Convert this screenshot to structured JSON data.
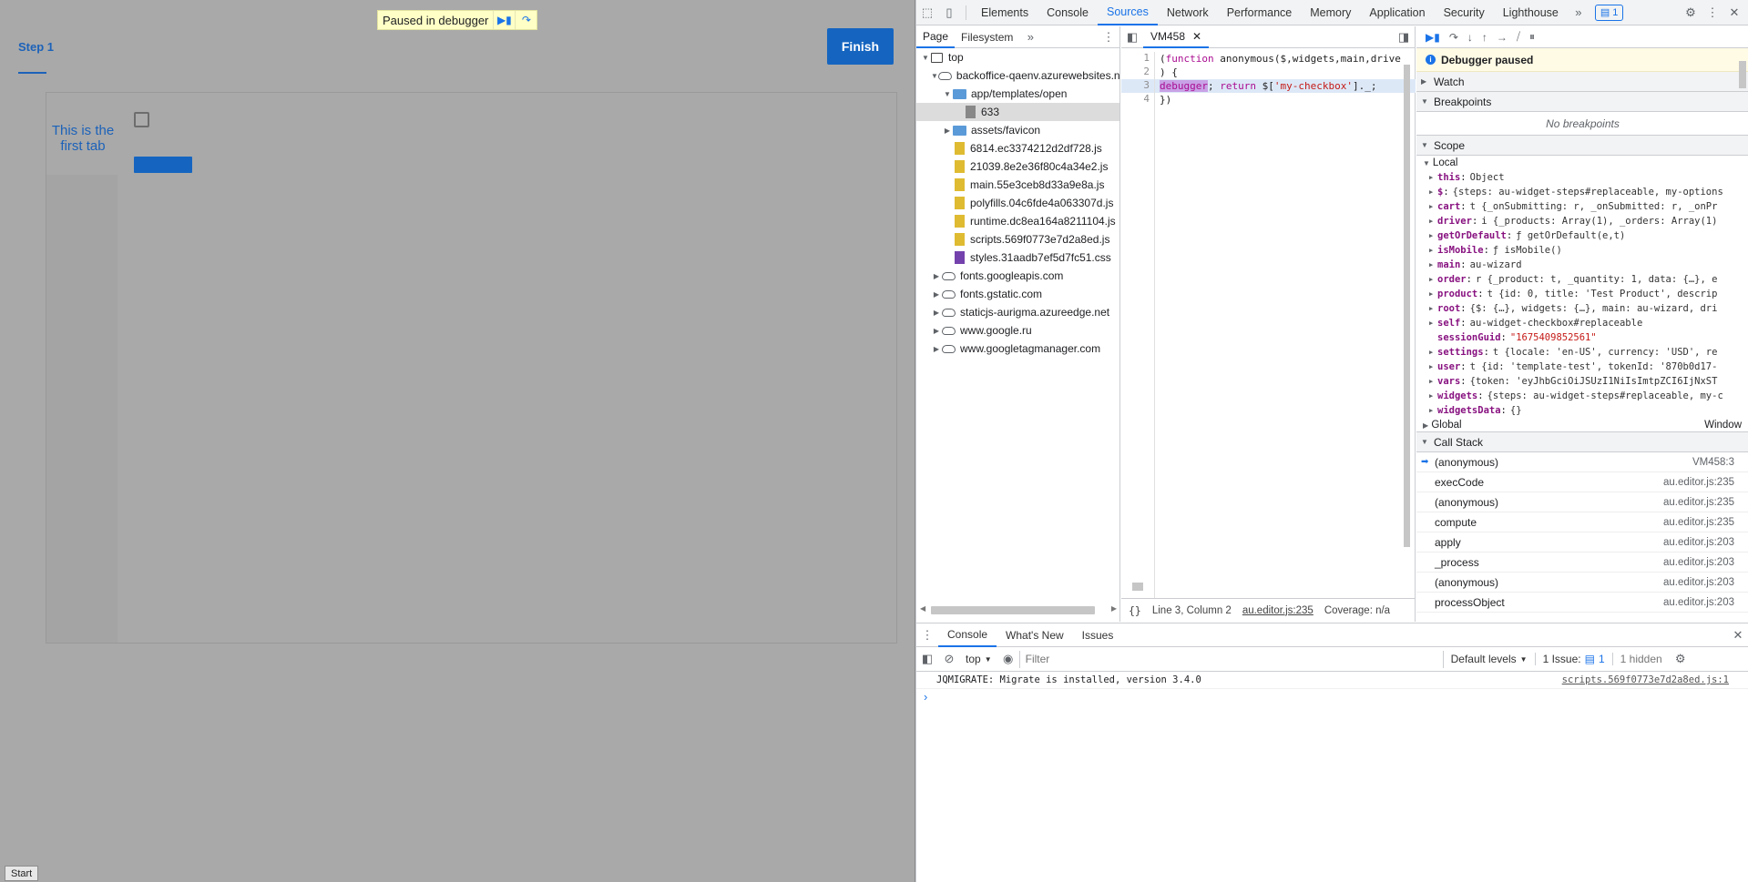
{
  "page": {
    "paused_banner": "Paused in debugger",
    "step_tab": "Step 1",
    "finish_button": "Finish",
    "tab_label": "This is the first tab",
    "start_button": "Start"
  },
  "devtools": {
    "tabs": [
      "Elements",
      "Console",
      "Sources",
      "Network",
      "Performance",
      "Memory",
      "Application",
      "Security",
      "Lighthouse"
    ],
    "active_tab": "Sources",
    "issues_count": "1",
    "navigator": {
      "tabs": [
        "Page",
        "Filesystem"
      ],
      "tree": [
        {
          "label": "top",
          "depth": 0,
          "icon": "frame",
          "expanded": true
        },
        {
          "label": "backoffice-qaenv.azurewebsites.net",
          "depth": 1,
          "icon": "cloud",
          "expanded": true
        },
        {
          "label": "app/templates/open",
          "depth": 2,
          "icon": "folder",
          "expanded": true
        },
        {
          "label": "633",
          "depth": 3,
          "icon": "file-doc",
          "selected": true
        },
        {
          "label": "assets/favicon",
          "depth": 2,
          "icon": "folder",
          "expanded": false
        },
        {
          "label": "6814.ec3374212d2df728.js",
          "depth": 2,
          "icon": "file-js"
        },
        {
          "label": "21039.8e2e36f80c4a34e2.js",
          "depth": 2,
          "icon": "file-js"
        },
        {
          "label": "main.55e3ceb8d33a9e8a.js",
          "depth": 2,
          "icon": "file-js"
        },
        {
          "label": "polyfills.04c6fde4a063307d.js",
          "depth": 2,
          "icon": "file-js"
        },
        {
          "label": "runtime.dc8ea164a8211104.js",
          "depth": 2,
          "icon": "file-js"
        },
        {
          "label": "scripts.569f0773e7d2a8ed.js",
          "depth": 2,
          "icon": "file-js"
        },
        {
          "label": "styles.31aadb7ef5d7fc51.css",
          "depth": 2,
          "icon": "file-css"
        },
        {
          "label": "fonts.googleapis.com",
          "depth": 1,
          "icon": "cloud",
          "expanded": false
        },
        {
          "label": "fonts.gstatic.com",
          "depth": 1,
          "icon": "cloud",
          "expanded": false
        },
        {
          "label": "staticjs-aurigma.azureedge.net",
          "depth": 1,
          "icon": "cloud",
          "expanded": false
        },
        {
          "label": "www.google.ru",
          "depth": 1,
          "icon": "cloud",
          "expanded": false
        },
        {
          "label": "www.googletagmanager.com",
          "depth": 1,
          "icon": "cloud",
          "expanded": false
        }
      ]
    },
    "editor": {
      "file_tab": "VM458",
      "status_position": "Line 3, Column 2",
      "status_source": "au.editor.js:235",
      "status_coverage": "Coverage: n/a"
    },
    "debugger": {
      "paused_message": "Debugger paused",
      "sections": {
        "watch": "Watch",
        "breakpoints": "Breakpoints",
        "scope": "Scope",
        "call_stack": "Call Stack"
      },
      "no_breakpoints": "No breakpoints",
      "scope_local": "Local",
      "scope_vars": [
        {
          "name": "this",
          "value": "Object",
          "kind": "obj",
          "expandable": true
        },
        {
          "name": "$",
          "value": "{steps: au-widget-steps#replaceable, my-options",
          "kind": "obj",
          "expandable": true
        },
        {
          "name": "cart",
          "value": "t {_onSubmitting: r, _onSubmitted: r, _onPr",
          "kind": "obj",
          "expandable": true
        },
        {
          "name": "driver",
          "value": "i {_products: Array(1), _orders: Array(1)",
          "kind": "obj",
          "expandable": true
        },
        {
          "name": "getOrDefault",
          "value": "ƒ getOrDefault(e,t)",
          "kind": "obj",
          "expandable": true
        },
        {
          "name": "isMobile",
          "value": "ƒ isMobile()",
          "kind": "obj",
          "expandable": true
        },
        {
          "name": "main",
          "value": "au-wizard",
          "kind": "obj",
          "expandable": true
        },
        {
          "name": "order",
          "value": "r {_product: t, _quantity: 1, data: {…}, e",
          "kind": "obj",
          "expandable": true
        },
        {
          "name": "product",
          "value": "t {id: 0, title: 'Test Product', descrip",
          "kind": "obj",
          "expandable": true
        },
        {
          "name": "root",
          "value": "{$: {…}, widgets: {…}, main: au-wizard, dri",
          "kind": "obj",
          "expandable": true
        },
        {
          "name": "self",
          "value": "au-widget-checkbox#replaceable",
          "kind": "obj",
          "expandable": true
        },
        {
          "name": "sessionGuid",
          "value": "\"1675409852561\"",
          "kind": "str",
          "expandable": false
        },
        {
          "name": "settings",
          "value": "t {locale: 'en-US', currency: 'USD', re",
          "kind": "obj",
          "expandable": true
        },
        {
          "name": "user",
          "value": "t {id: 'template-test', tokenId: '870b0d17-",
          "kind": "obj",
          "expandable": true
        },
        {
          "name": "vars",
          "value": "{token: 'eyJhbGciOiJSUzI1NiIsImtpZCI6IjNxST",
          "kind": "obj",
          "expandable": true
        },
        {
          "name": "widgets",
          "value": "{steps: au-widget-steps#replaceable, my-c",
          "kind": "obj",
          "expandable": true
        },
        {
          "name": "widgetsData",
          "value": "{}",
          "kind": "obj",
          "expandable": true
        }
      ],
      "scope_global": "Global",
      "scope_global_value": "Window",
      "call_stack": [
        {
          "fn": "(anonymous)",
          "loc": "VM458:3",
          "current": true
        },
        {
          "fn": "execCode",
          "loc": "au.editor.js:235"
        },
        {
          "fn": "(anonymous)",
          "loc": "au.editor.js:235"
        },
        {
          "fn": "compute",
          "loc": "au.editor.js:235"
        },
        {
          "fn": "apply",
          "loc": "au.editor.js:203"
        },
        {
          "fn": "_process",
          "loc": "au.editor.js:203"
        },
        {
          "fn": "(anonymous)",
          "loc": "au.editor.js:203"
        },
        {
          "fn": "processObject",
          "loc": "au.editor.js:203"
        }
      ]
    },
    "drawer": {
      "tabs": [
        "Console",
        "What's New",
        "Issues"
      ],
      "context": "top",
      "filter_placeholder": "Filter",
      "levels": "Default levels",
      "issues_label": "1 Issue:",
      "issues_count": "1",
      "hidden": "1 hidden",
      "messages": [
        {
          "text": "JQMIGRATE: Migrate is installed, version 3.4.0",
          "source": "scripts.569f0773e7d2a8ed.js:1"
        }
      ]
    }
  }
}
